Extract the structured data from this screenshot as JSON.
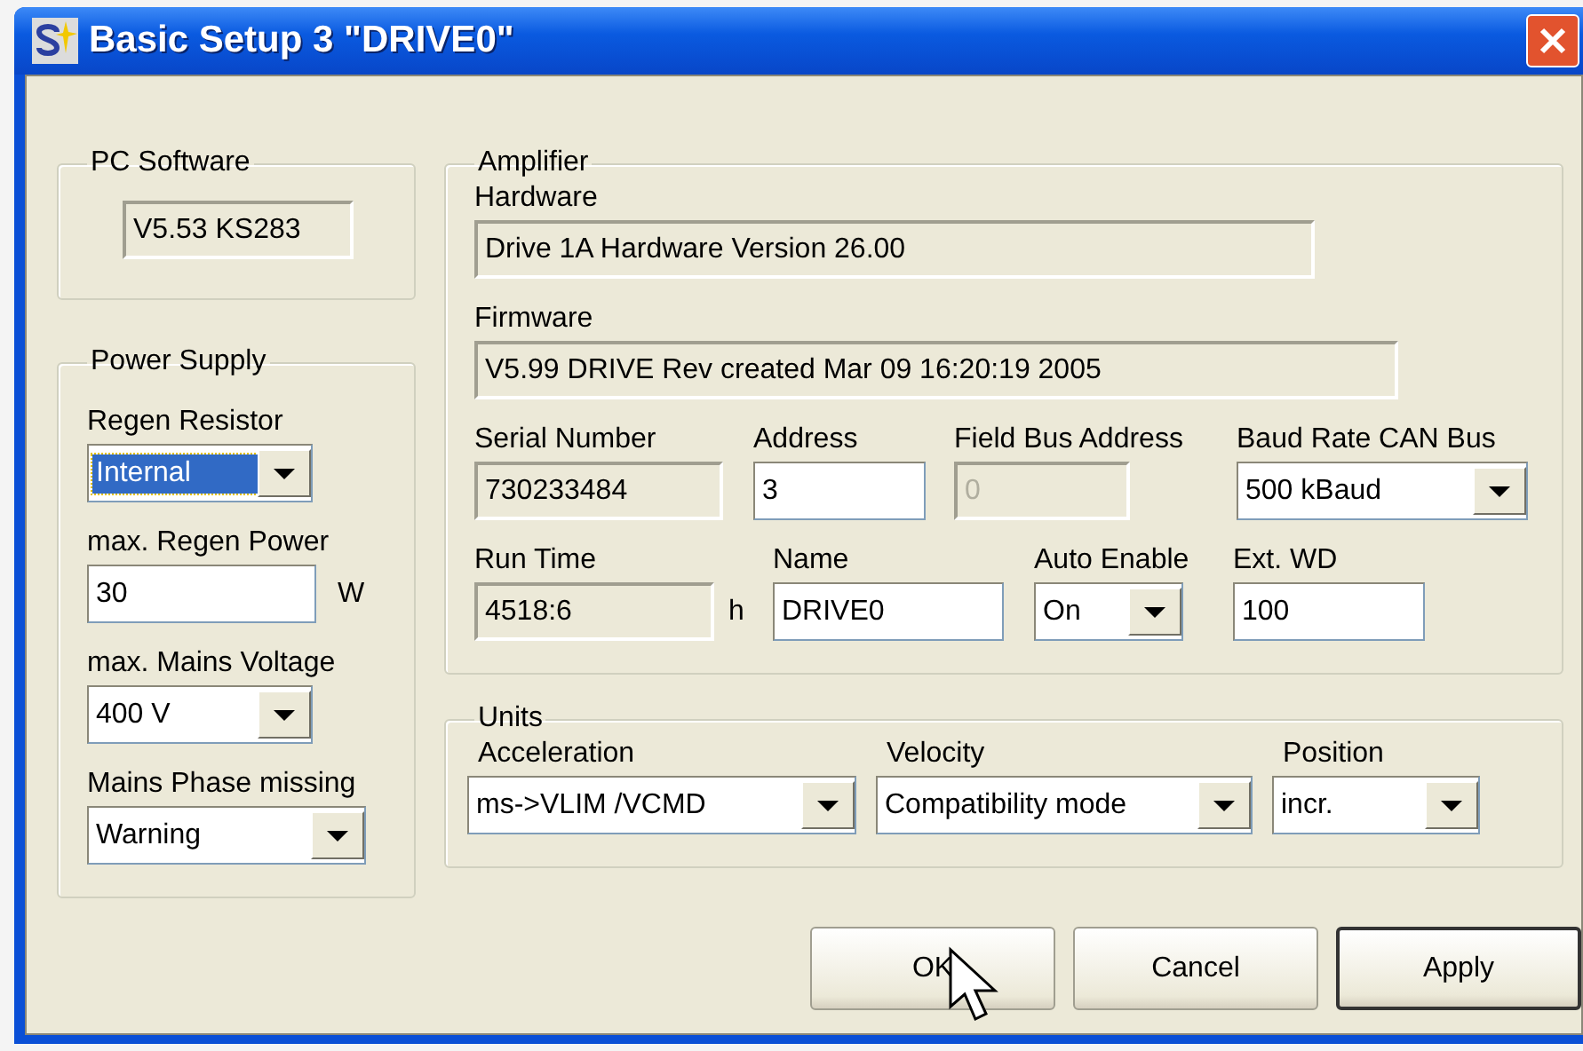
{
  "window": {
    "title": "Basic Setup 3 \"DRIVE0\""
  },
  "pc_software": {
    "title": "PC Software",
    "version": "V5.53 KS283"
  },
  "power_supply": {
    "title": "Power Supply",
    "fields": [
      {
        "label": "Regen Resistor",
        "kind": "select",
        "value": "Internal",
        "focused": true
      },
      {
        "label": "max. Regen Power",
        "kind": "input",
        "value": "30",
        "unit": "W",
        "focused": false
      },
      {
        "label": "max. Mains Voltage",
        "kind": "select",
        "value": "400 V",
        "focused": false
      },
      {
        "label": "Mains Phase missing",
        "kind": "select",
        "value": "Warning",
        "focused": false
      }
    ]
  },
  "amplifier": {
    "title": "Amplifier",
    "hardware": {
      "label": "Hardware",
      "value": "Drive 1A Hardware Version 26.00"
    },
    "firmware": {
      "label": "Firmware",
      "value": "V5.99 DRIVE Rev created Mar 09 16:20:19 2005"
    },
    "rows": [
      [
        {
          "label": "Serial Number",
          "kind": "readonly",
          "value": "730233484"
        },
        {
          "label": "Address",
          "kind": "input",
          "value": "3"
        },
        {
          "label": "Field Bus Address",
          "kind": "disabled",
          "value": "0"
        },
        {
          "label": "Baud Rate CAN Bus",
          "kind": "select",
          "value": "500 kBaud"
        }
      ],
      [
        {
          "label": "Run Time",
          "kind": "readonly",
          "value": "4518:6",
          "unit": "h"
        },
        {
          "label": "Name",
          "kind": "input",
          "value": "DRIVE0"
        },
        {
          "label": "Auto Enable",
          "kind": "select",
          "value": "On"
        },
        {
          "label": "Ext. WD",
          "kind": "input",
          "value": "100"
        }
      ]
    ]
  },
  "units": {
    "title": "Units",
    "fields": [
      {
        "label": "Acceleration",
        "kind": "select",
        "value": "ms->VLIM /VCMD"
      },
      {
        "label": "Velocity",
        "kind": "select",
        "value": "Compatibility mode"
      },
      {
        "label": "Position",
        "kind": "select",
        "value": "incr."
      }
    ]
  },
  "buttons": [
    {
      "label": "OK",
      "default": false
    },
    {
      "label": "Cancel",
      "default": false
    },
    {
      "label": "Apply",
      "default": true
    }
  ]
}
